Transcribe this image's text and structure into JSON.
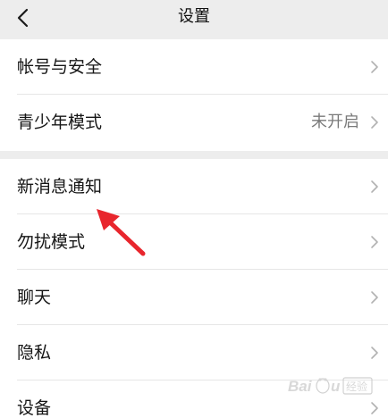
{
  "header": {
    "title": "设置",
    "back_icon": "chevron-left-icon"
  },
  "groups": [
    {
      "items": [
        {
          "label": "帐号与安全",
          "value": ""
        },
        {
          "label": "青少年模式",
          "value": "未开启"
        }
      ]
    },
    {
      "items": [
        {
          "label": "新消息通知",
          "value": ""
        },
        {
          "label": "勿扰模式",
          "value": ""
        },
        {
          "label": "聊天",
          "value": ""
        },
        {
          "label": "隐私",
          "value": ""
        },
        {
          "label": "设备",
          "value": ""
        }
      ]
    }
  ],
  "annotation": {
    "color": "#e8262d",
    "target": "新消息通知"
  },
  "watermark": {
    "text": "Baidu 经验"
  },
  "colors": {
    "background": "#ededed",
    "row_background": "#ffffff",
    "chevron": "#b2b2b2",
    "value_text": "#7a7a7a"
  }
}
